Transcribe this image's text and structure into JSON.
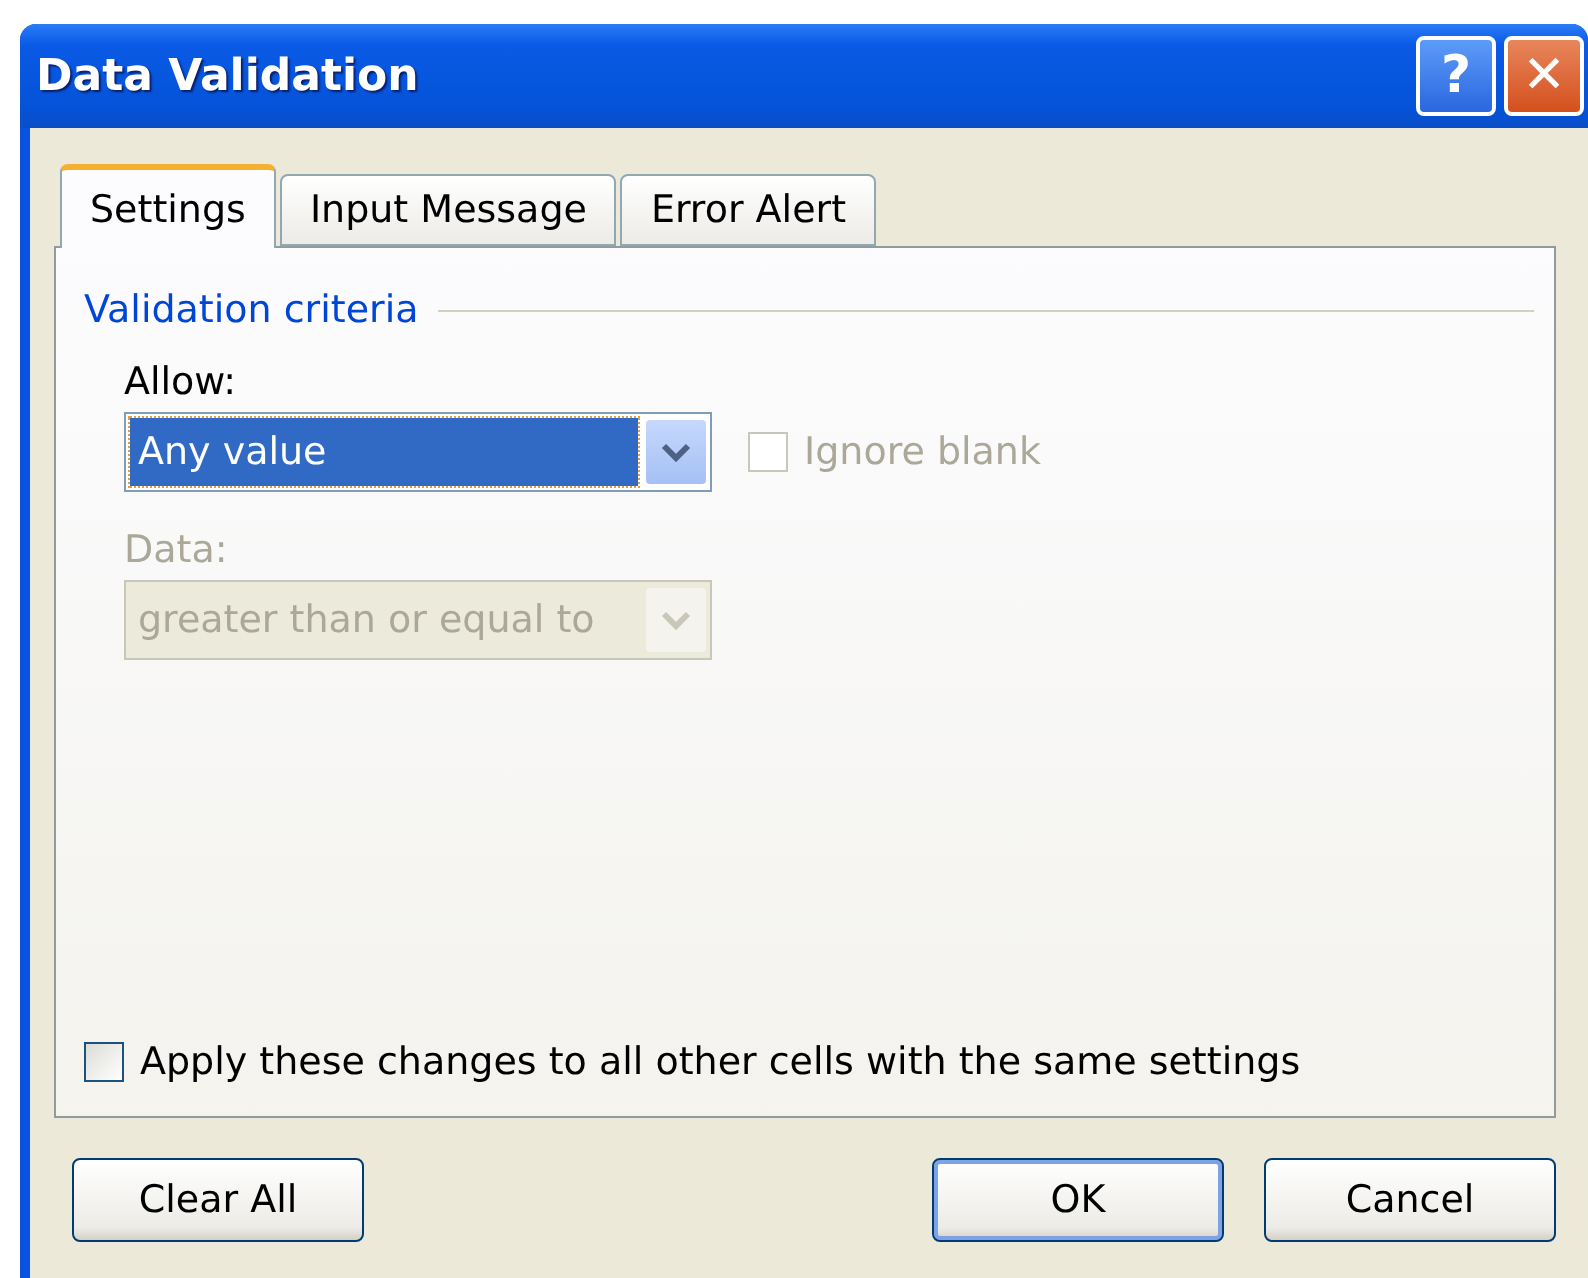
{
  "window": {
    "title": "Data Validation",
    "help_button": "?",
    "close_button": "✕"
  },
  "tabs": [
    {
      "label": "Settings",
      "selected": true
    },
    {
      "label": "Input Message",
      "selected": false
    },
    {
      "label": "Error Alert",
      "selected": false
    }
  ],
  "group": {
    "title": "Validation criteria"
  },
  "allow": {
    "label": "Allow:",
    "value": "Any value",
    "disabled": false,
    "focused": true
  },
  "ignore_blank": {
    "label": "Ignore blank",
    "checked": false,
    "disabled": true
  },
  "data": {
    "label": "Data:",
    "value": "greater than or equal to",
    "disabled": true,
    "focused": false
  },
  "apply_all": {
    "label": "Apply these changes to all other cells with the same settings",
    "checked": false,
    "disabled": false
  },
  "buttons": [
    {
      "label": "Clear All",
      "default": false
    },
    {
      "label": "OK",
      "default": true
    },
    {
      "label": "Cancel",
      "default": false
    }
  ]
}
